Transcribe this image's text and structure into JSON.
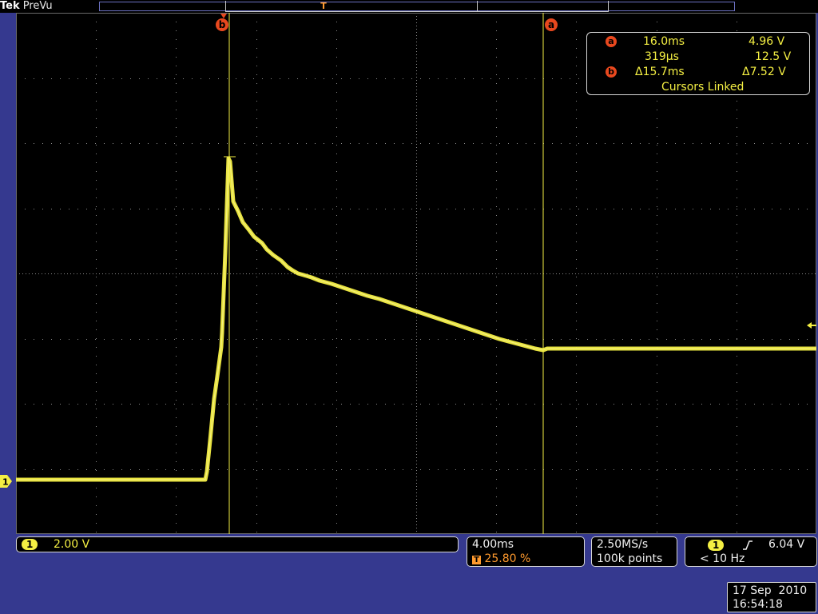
{
  "brand": {
    "maker": "Tek",
    "mode": "PreVu"
  },
  "trigger_marker": "T",
  "cursors": {
    "a_label": "a",
    "b_label": "b"
  },
  "readout": {
    "a_time": "16.0ms",
    "a_volt": "4.96 V",
    "b_time": "319µs",
    "b_volt": "12.5 V",
    "delta_time": "Δ15.7ms",
    "delta_volt": "Δ7.52 V",
    "mode": "Cursors Linked"
  },
  "channel": {
    "number": "1",
    "scale": "2.00 V"
  },
  "horizontal": {
    "timebase": "4.00ms",
    "trigger_position": "25.80 %"
  },
  "acquisition": {
    "sample_rate": "2.50MS/s",
    "record_length": "100k points"
  },
  "trigger": {
    "source": "1",
    "level": "6.04 V",
    "frequency": "< 10 Hz"
  },
  "datetime": {
    "date": "17 Sep  2010",
    "time": "16:54:18"
  },
  "colors": {
    "trace": "#f4ef43",
    "cursor": "#f4ef43",
    "cursor_label": "#e8481e",
    "background": "#35398f"
  }
}
